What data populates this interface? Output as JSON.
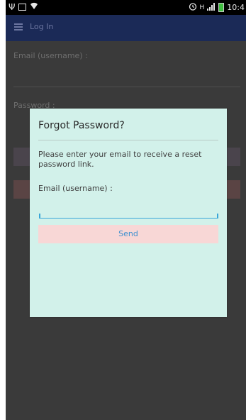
{
  "status_bar": {
    "usb_icon": "usb-icon",
    "image_icon": "image-icon",
    "wifi_icon": "wifi-icon",
    "alarm_icon": "alarm-icon",
    "h_icon": "network-h-icon",
    "signal_icon": "signal-icon",
    "battery_icon": "battery-icon",
    "time": "10:4"
  },
  "app_bar": {
    "menu_icon": "hamburger-menu-icon",
    "title": "Log In"
  },
  "background_form": {
    "email_label": "Email (username) :",
    "password_label": "Password :"
  },
  "dialog": {
    "title": "Forgot Password?",
    "message": "Please enter your email to receive a reset password link.",
    "email_label": "Email (username) :",
    "email_value": "",
    "send_label": "Send"
  },
  "colors": {
    "app_bar": "#1b2a57",
    "dialog_background": "#d2f1ea",
    "send_button_bg": "#f8d7d6",
    "send_button_text": "#3b8fd0",
    "input_underline": "#3aa6d8"
  }
}
